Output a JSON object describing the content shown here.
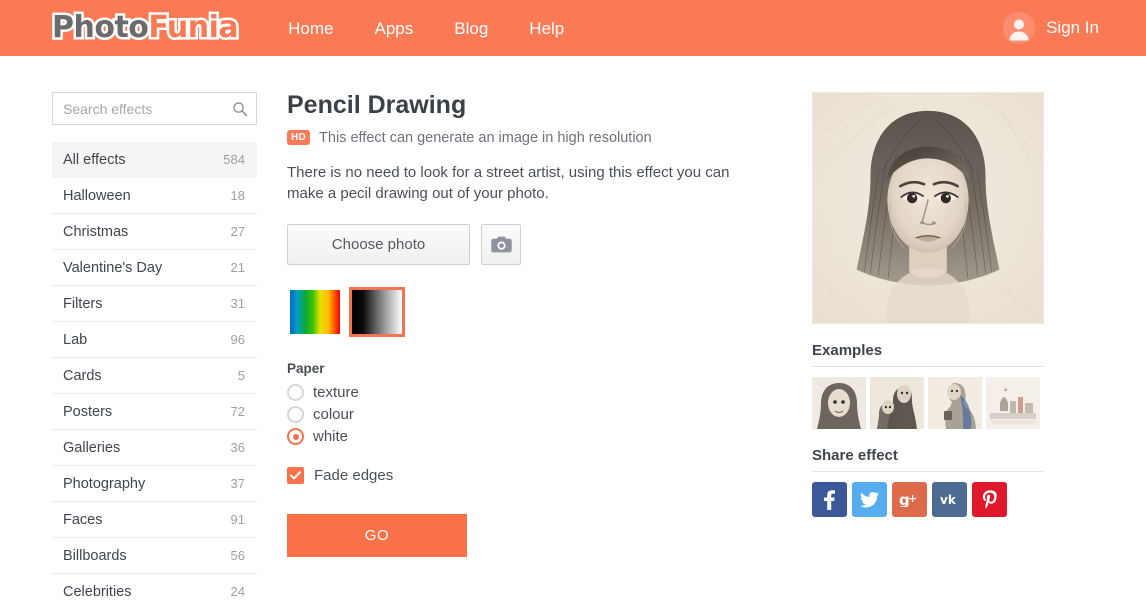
{
  "header": {
    "logo_part1": "Photo",
    "logo_part2": "Funia",
    "nav": [
      {
        "label": "Home"
      },
      {
        "label": "Apps"
      },
      {
        "label": "Blog"
      },
      {
        "label": "Help"
      }
    ],
    "signin_label": "Sign In",
    "avatar_icon": "user-avatar-icon",
    "brand_color": "#fb7a56"
  },
  "sidebar": {
    "search": {
      "placeholder": "Search effects",
      "value": "",
      "icon": "search-icon"
    },
    "categories": [
      {
        "label": "All effects",
        "count": "584",
        "active": true
      },
      {
        "label": "Halloween",
        "count": "18",
        "active": false
      },
      {
        "label": "Christmas",
        "count": "27",
        "active": false
      },
      {
        "label": "Valentine's Day",
        "count": "21",
        "active": false
      },
      {
        "label": "Filters",
        "count": "31",
        "active": false
      },
      {
        "label": "Lab",
        "count": "96",
        "active": false
      },
      {
        "label": "Cards",
        "count": "5",
        "active": false
      },
      {
        "label": "Posters",
        "count": "72",
        "active": false
      },
      {
        "label": "Galleries",
        "count": "36",
        "active": false
      },
      {
        "label": "Photography",
        "count": "37",
        "active": false
      },
      {
        "label": "Faces",
        "count": "91",
        "active": false
      },
      {
        "label": "Billboards",
        "count": "56",
        "active": false
      },
      {
        "label": "Celebrities",
        "count": "24",
        "active": false
      }
    ]
  },
  "main": {
    "title": "Pencil Drawing",
    "hd_badge": "HD",
    "hd_text": "This effect can generate an image in high resolution",
    "description": "There is no need to look for a street artist, using this effect you can make a pecil drawing out of your photo.",
    "choose_photo_label": "Choose photo",
    "camera_icon": "camera-icon",
    "swatches": [
      {
        "name": "colour-gradient-swatch",
        "selected": false
      },
      {
        "name": "grayscale-gradient-swatch",
        "selected": true
      }
    ],
    "paper": {
      "label": "Paper",
      "options": [
        {
          "label": "texture",
          "checked": false
        },
        {
          "label": "colour",
          "checked": false
        },
        {
          "label": "white",
          "checked": true
        }
      ]
    },
    "fade_edges": {
      "label": "Fade edges",
      "checked": true
    },
    "go_label": "GO",
    "accent_color": "#fb7149"
  },
  "right": {
    "preview_alt": "pencil drawing portrait preview",
    "examples_heading": "Examples",
    "examples": [
      {
        "name": "example-thumb-portrait-woman"
      },
      {
        "name": "example-thumb-couple"
      },
      {
        "name": "example-thumb-person-scarf"
      },
      {
        "name": "example-thumb-cityscape"
      }
    ],
    "share_heading": "Share effect",
    "share_buttons": [
      {
        "name": "facebook",
        "glyph": "f",
        "color": "#3b5998"
      },
      {
        "name": "twitter",
        "glyph": "t",
        "color": "#55acee"
      },
      {
        "name": "google-plus",
        "glyph": "g+",
        "color": "#dd6a4a"
      },
      {
        "name": "vk",
        "glyph": "vk",
        "color": "#4c6c91"
      },
      {
        "name": "pinterest",
        "glyph": "p",
        "color": "#e0182c"
      }
    ]
  }
}
